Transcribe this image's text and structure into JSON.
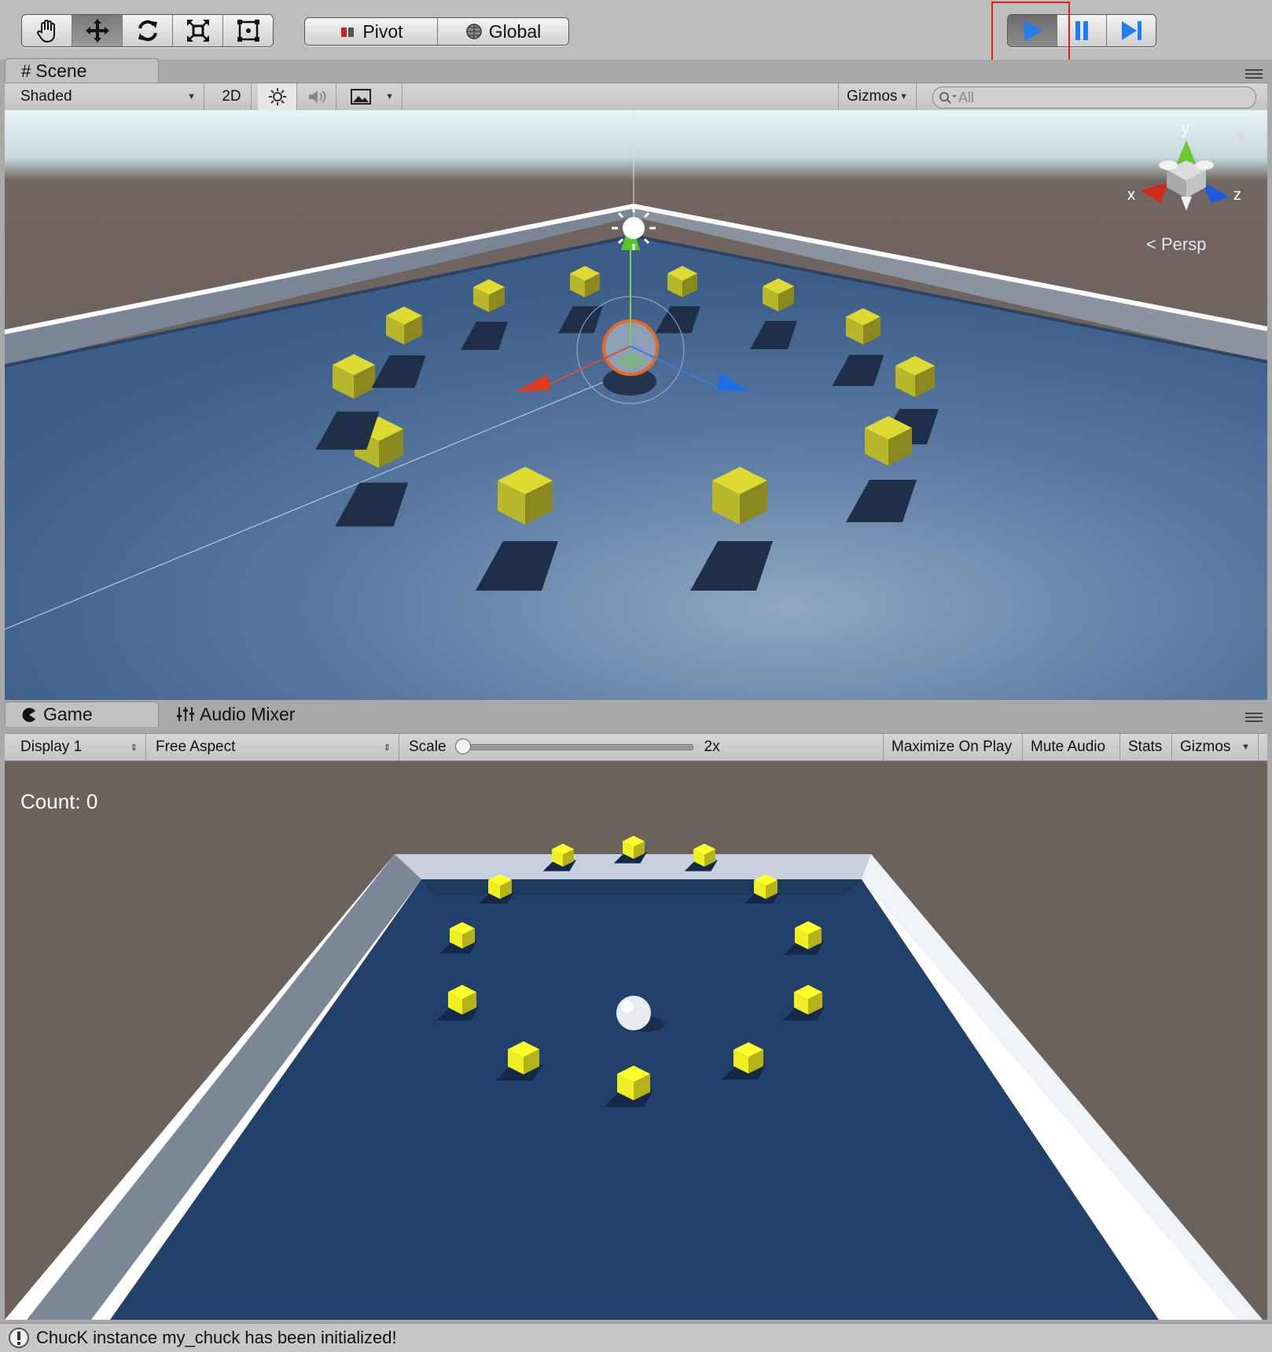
{
  "toolbar": {
    "tools": [
      {
        "name": "hand-tool",
        "icon": "hand-icon"
      },
      {
        "name": "move-tool",
        "icon": "move-arrows-icon"
      },
      {
        "name": "rotate-tool",
        "icon": "rotate-icon"
      },
      {
        "name": "scale-tool",
        "icon": "scale-icon"
      },
      {
        "name": "rect-tool",
        "icon": "rect-transform-icon"
      }
    ],
    "active_tool": "move-tool",
    "pivot_label": "Pivot",
    "global_label": "Global",
    "playback": {
      "play_icon": "play-icon",
      "pause_icon": "pause-icon",
      "step_icon": "step-icon",
      "playing": true
    }
  },
  "scene_panel": {
    "tab_label": "Scene",
    "shading_mode": "Shaded",
    "mode_2d_label": "2D",
    "gizmos_label": "Gizmos",
    "search_placeholder": "All",
    "orientation_gizmo": {
      "y": "y",
      "x": "x",
      "z": "z",
      "projection_label": "Persp"
    }
  },
  "game_panel": {
    "tabs": [
      {
        "label": "Game",
        "active": true
      },
      {
        "label": "Audio Mixer",
        "active": false
      }
    ],
    "display": "Display 1",
    "aspect": "Free Aspect",
    "scale_label": "Scale",
    "scale_value": "2x",
    "scale_slider_fraction": 0,
    "buttons": [
      "Maximize On Play",
      "Mute Audio",
      "Stats",
      "Gizmos"
    ],
    "hud_count_text": "Count: 0"
  },
  "status": {
    "message": "ChucK instance my_chuck has been initialized!",
    "icon": "info-icon"
  },
  "colors": {
    "pickup_cube": "#b8b62a",
    "game_cube": "#f0ee22",
    "ground": "#3d5f88",
    "wall": "#ffffff",
    "play_accent": "#1e7df0",
    "highlight": "#e0201f"
  }
}
